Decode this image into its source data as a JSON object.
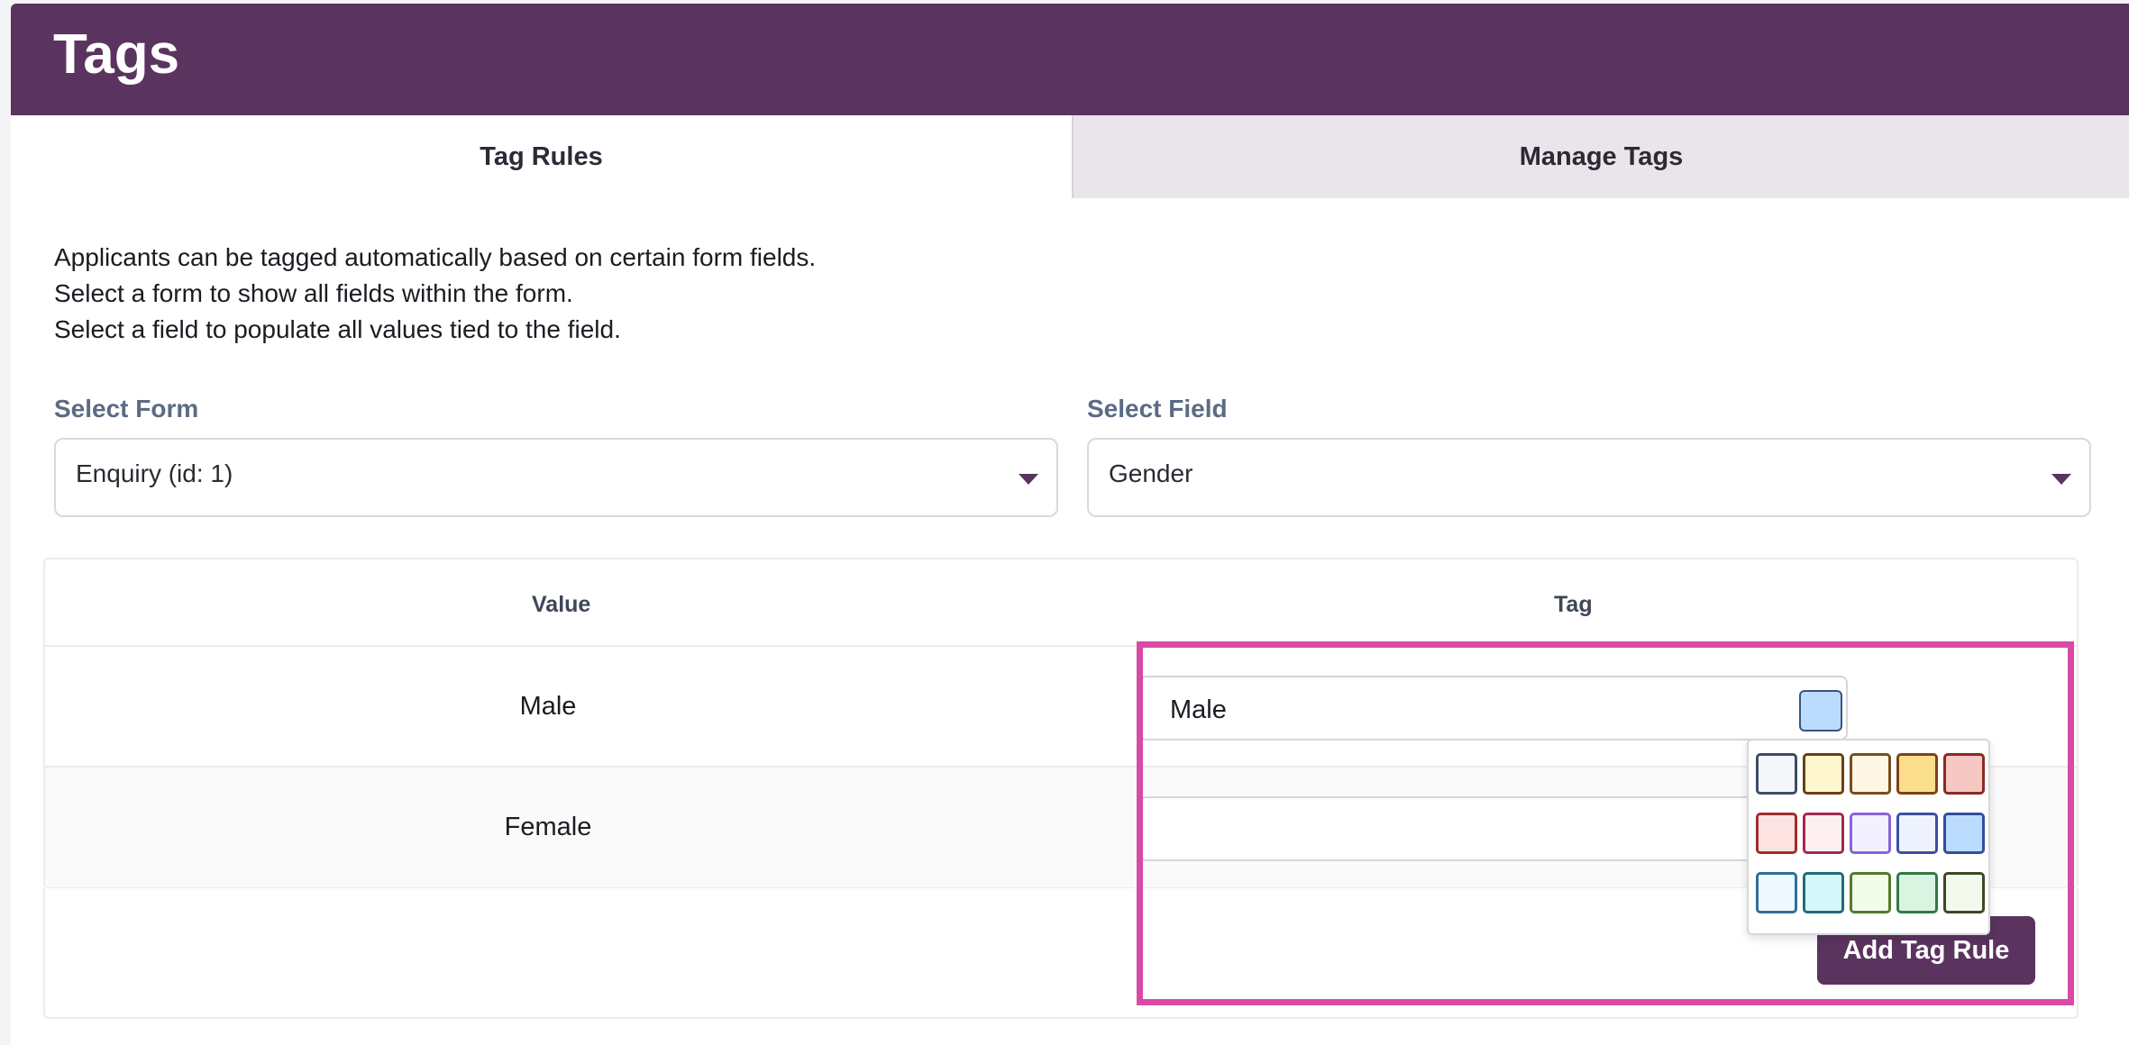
{
  "header": {
    "title": "Tags"
  },
  "tabs": [
    {
      "label": "Tag Rules",
      "active": true
    },
    {
      "label": "Manage Tags",
      "active": false
    }
  ],
  "intro": [
    "Applicants can be tagged automatically based on certain form fields.",
    "Select a form to show all fields within the form.",
    "Select a field to populate all values tied to the field."
  ],
  "select_form": {
    "label": "Select Form",
    "value": "Enquiry (id: 1)"
  },
  "select_field": {
    "label": "Select Field",
    "value": "Gender"
  },
  "table": {
    "headers": {
      "value": "Value",
      "tag": "Tag"
    },
    "rows": [
      {
        "value": "Male",
        "tag": "Male",
        "tag_color": "#bcdcff"
      },
      {
        "value": "Female",
        "tag": ""
      }
    ]
  },
  "add_button": {
    "label": "Add Tag Rule"
  },
  "colors": {
    "brand": "#5a345e",
    "tab_inactive": "#e9e5ea",
    "label": "#5b6b85",
    "highlight": "#d84aa5"
  },
  "palette": [
    [
      {
        "fill": "#f4f6fa",
        "border": "#3f4c64"
      },
      {
        "fill": "#fdf6cf",
        "border": "#6a3f17"
      },
      {
        "fill": "#fef7e6",
        "border": "#7a4d1d"
      },
      {
        "fill": "#fbde8b",
        "border": "#7a4314"
      },
      {
        "fill": "#f5c8c4",
        "border": "#8a2a22"
      }
    ],
    [
      {
        "fill": "#fde2e2",
        "border": "#a12c2c"
      },
      {
        "fill": "#fdeff2",
        "border": "#a2294a"
      },
      {
        "fill": "#f3f0ff",
        "border": "#8a63d8"
      },
      {
        "fill": "#eef3ff",
        "border": "#3b4fa0"
      },
      {
        "fill": "#bcdcff",
        "border": "#2f4f9a"
      }
    ],
    [
      {
        "fill": "#eef9ff",
        "border": "#2f6f99"
      },
      {
        "fill": "#d5f6fb",
        "border": "#1f6d77"
      },
      {
        "fill": "#f3fbea",
        "border": "#557a2a"
      },
      {
        "fill": "#d9f5e2",
        "border": "#2f7a45"
      },
      {
        "fill": "#f4f9ee",
        "border": "#3a4a26"
      }
    ]
  ]
}
